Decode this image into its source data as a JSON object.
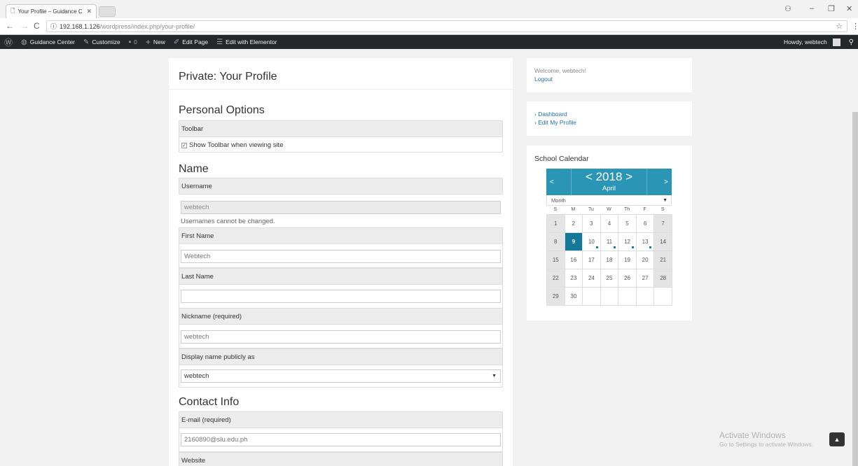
{
  "browser": {
    "tab_title": "Your Profile – Guidance C",
    "tab_close": "✕",
    "url_host": "192.168.1.126",
    "url_path": "/wordpress/index.php/your-profile/"
  },
  "adminbar": {
    "site_name": "Guidance Center",
    "customize": "Customize",
    "comments_count": "0",
    "new": "New",
    "edit_page": "Edit Page",
    "edit_elementor": "Edit with Elementor",
    "howdy": "Howdy, webtech"
  },
  "content": {
    "page_title": "Private: Your Profile",
    "personal_options": {
      "heading": "Personal Options",
      "toolbar_label": "Toolbar",
      "toolbar_checkbox": "Show Toolbar when viewing site"
    },
    "name": {
      "heading": "Name",
      "username_label": "Username",
      "username_value": "webtech",
      "username_note": "Usernames cannot be changed.",
      "first_name_label": "First Name",
      "first_name_value": "Webtech",
      "last_name_label": "Last Name",
      "last_name_value": "",
      "nickname_label": "Nickname (required)",
      "nickname_value": "webtech",
      "display_name_label": "Display name publicly as",
      "display_name_value": "webtech"
    },
    "contact": {
      "heading": "Contact Info",
      "email_label": "E-mail (required)",
      "email_value": "2160890@slu.edu.ph",
      "website_label": "Website"
    }
  },
  "sidebar": {
    "welcome": "Welcome, webtech!",
    "logout": "Logout",
    "links": [
      "› Dashboard",
      "› Edit My Profile"
    ],
    "calendar": {
      "title": "School Calendar",
      "prev": "<",
      "next": ">",
      "year": "< 2018 >",
      "month": "April",
      "view": "Month",
      "dow": [
        "S",
        "M",
        "Tu",
        "W",
        "Th",
        "F",
        "S"
      ],
      "today": 9,
      "event_days": [
        10,
        11,
        12,
        13
      ]
    }
  },
  "watermark": {
    "line1": "Activate Windows",
    "line2": "Go to Settings to activate Windows."
  }
}
